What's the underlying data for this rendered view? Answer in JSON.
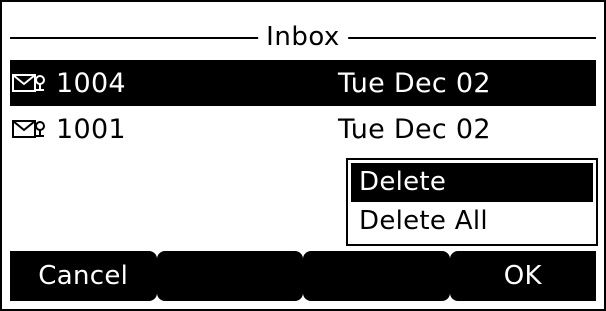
{
  "header": {
    "title": "Inbox"
  },
  "messages": [
    {
      "icon": "voicemail-envelope-icon",
      "number": "1004",
      "date": "Tue Dec 02",
      "selected": true
    },
    {
      "icon": "voicemail-envelope-icon",
      "number": "1001",
      "date": "Tue Dec 02",
      "selected": false
    }
  ],
  "popup_menu": {
    "items": [
      {
        "label": "Delete",
        "selected": true
      },
      {
        "label": "Delete All",
        "selected": false
      }
    ]
  },
  "softkeys": {
    "key1": "Cancel",
    "key2": "",
    "key3": "",
    "key4": "OK"
  },
  "colors": {
    "background": "#ffffff",
    "foreground": "#000000",
    "highlight": "#000000",
    "highlight_text": "#ffffff"
  }
}
